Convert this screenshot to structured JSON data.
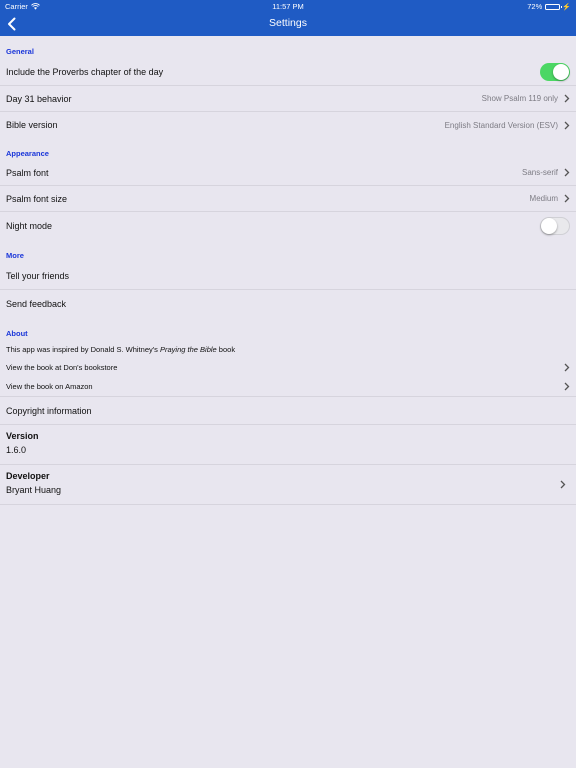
{
  "status_bar": {
    "carrier": "Carrier",
    "time": "11:57 PM",
    "battery_text": "72%",
    "battery_level": 0.72
  },
  "nav": {
    "title": "Settings"
  },
  "general": {
    "header": "General",
    "include_proverbs_label": "Include the Proverbs chapter of the day",
    "include_proverbs_on": true,
    "day31_label": "Day 31 behavior",
    "day31_value": "Show Psalm 119 only",
    "bible_version_label": "Bible version",
    "bible_version_value": "English Standard Version (ESV)"
  },
  "appearance": {
    "header": "Appearance",
    "psalm_font_label": "Psalm font",
    "psalm_font_value": "Sans-serif",
    "psalm_font_size_label": "Psalm font size",
    "psalm_font_size_value": "Medium",
    "night_mode_label": "Night mode",
    "night_mode_on": false
  },
  "more": {
    "header": "More",
    "tell_friends_label": "Tell your friends",
    "send_feedback_label": "Send feedback"
  },
  "about": {
    "header": "About",
    "inspired_prefix": "This app was inspired by Donald S. Whitney's ",
    "inspired_book": "Praying the Bible",
    "inspired_suffix": " book",
    "link_bookstore": "View the book at Don's bookstore",
    "link_amazon": "View the book on Amazon",
    "copyright_label": "Copyright information",
    "version_label": "Version",
    "version_value": "1.6.0",
    "developer_label": "Developer",
    "developer_value": "Bryant Huang"
  },
  "colors": {
    "nav_background": "#1f5bc4",
    "section_header": "#1a36d9",
    "toggle_on": "#4cd764",
    "background": "#e8e6ef"
  }
}
